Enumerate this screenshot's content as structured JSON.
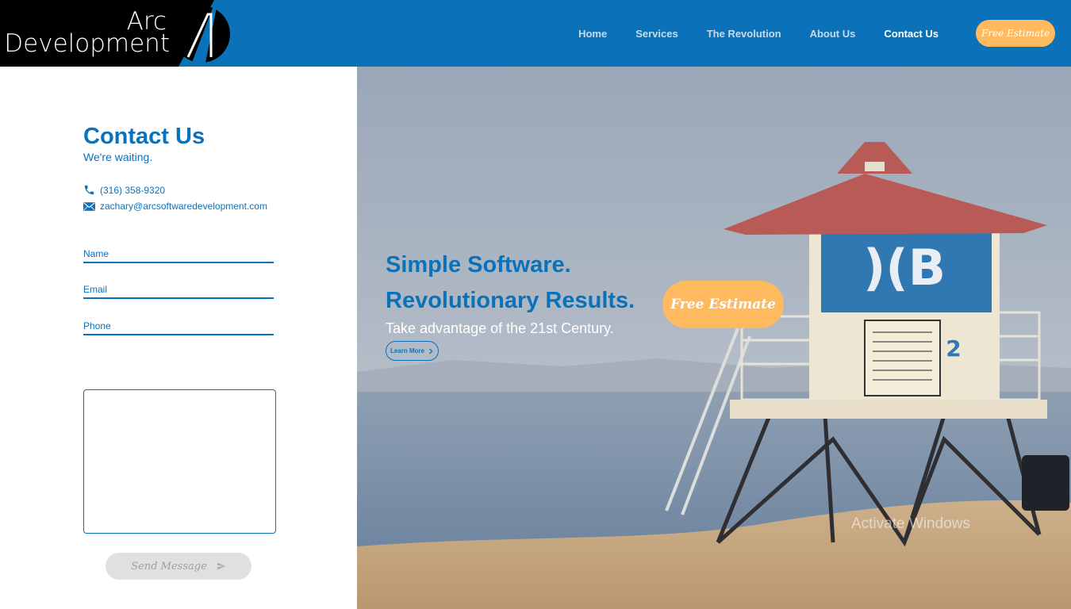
{
  "logo": {
    "line1": "Arc",
    "line2": "Development"
  },
  "nav": {
    "items": [
      {
        "label": "Home",
        "active": false
      },
      {
        "label": "Services",
        "active": false
      },
      {
        "label": "The Revolution",
        "active": false
      },
      {
        "label": "About Us",
        "active": false
      },
      {
        "label": "Contact Us",
        "active": true
      }
    ],
    "estimate_label": "Free Estimate"
  },
  "contact": {
    "title": "Contact Us",
    "subtitle": "We're waiting.",
    "phone": "(316) 358-9320",
    "email": "zachary@arcsoftwaredevelopment.com",
    "fields": {
      "name_placeholder": "Name",
      "email_placeholder": "Email",
      "phone_placeholder": "Phone",
      "message_value": ""
    },
    "send_label": "Send Message"
  },
  "hero": {
    "line1": "Simple Software.",
    "line2": "Revolutionary Results.",
    "subtext": "Take advantage of the 21st Century.",
    "learn_more": "Learn More",
    "estimate_label": "Free Estimate",
    "watermark": "Activate Windows"
  },
  "colors": {
    "primary": "#0b72b9",
    "accent": "#ffba60"
  }
}
